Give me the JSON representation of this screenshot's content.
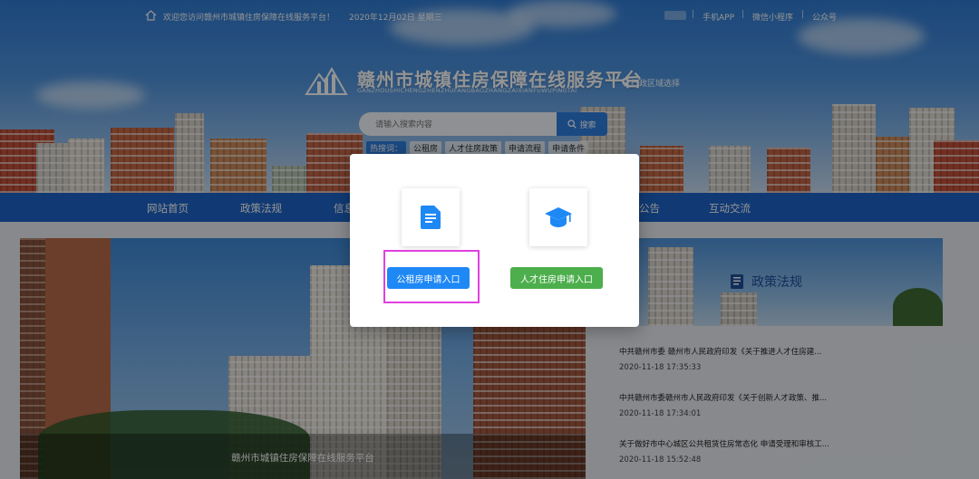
{
  "topbar": {
    "welcome": "欢迎您访问赣州市城镇住房保障在线服务平台！",
    "date": "2020年12月02日  星期三",
    "links": [
      "手机APP",
      "微信小程序",
      "公众号"
    ]
  },
  "header": {
    "title": "赣州市城镇住房保障在线服务平台",
    "subtitle": "GANZHOUSHICHENGZHENZHUFANGBAOZHANGZAIXIANFUWUPINGTAI",
    "region": "行政区域选择"
  },
  "search": {
    "placeholder": "请输入搜索内容",
    "button": "搜索",
    "hot_label": "热搜词：",
    "hot_words": [
      "公租房",
      "人才住房政策",
      "申请流程",
      "申请条件"
    ]
  },
  "nav": {
    "items": [
      "网站首页",
      "政策法规",
      "信息",
      "公告",
      "互动交流"
    ]
  },
  "banner": {
    "caption": "赣州市城镇住房保障在线服务平台"
  },
  "side": {
    "title": "政策法规",
    "news": [
      {
        "title": "中共赣州市委 赣州市人民政府印发《关于推进人才住房建...",
        "date": "2020-11-18 17:35:33"
      },
      {
        "title": "中共赣州市委赣州市人民政府印发《关于创新人才政策、推...",
        "date": "2020-11-18 17:34:01"
      },
      {
        "title": "关于做好市中心城区公共租赁住房常态化 申请受理和审核工...",
        "date": "2020-11-18 15:52:48"
      }
    ]
  },
  "modal": {
    "public_rental_button": "公租房申请入口",
    "talent_housing_button": "人才住房申请入口",
    "icons": [
      "document-icon",
      "graduation-cap-icon"
    ],
    "highlight_color": "#e040e0"
  },
  "colors": {
    "primary_blue": "#1e88f5",
    "nav_blue": "#1e64c8",
    "green": "#4cae4c"
  }
}
